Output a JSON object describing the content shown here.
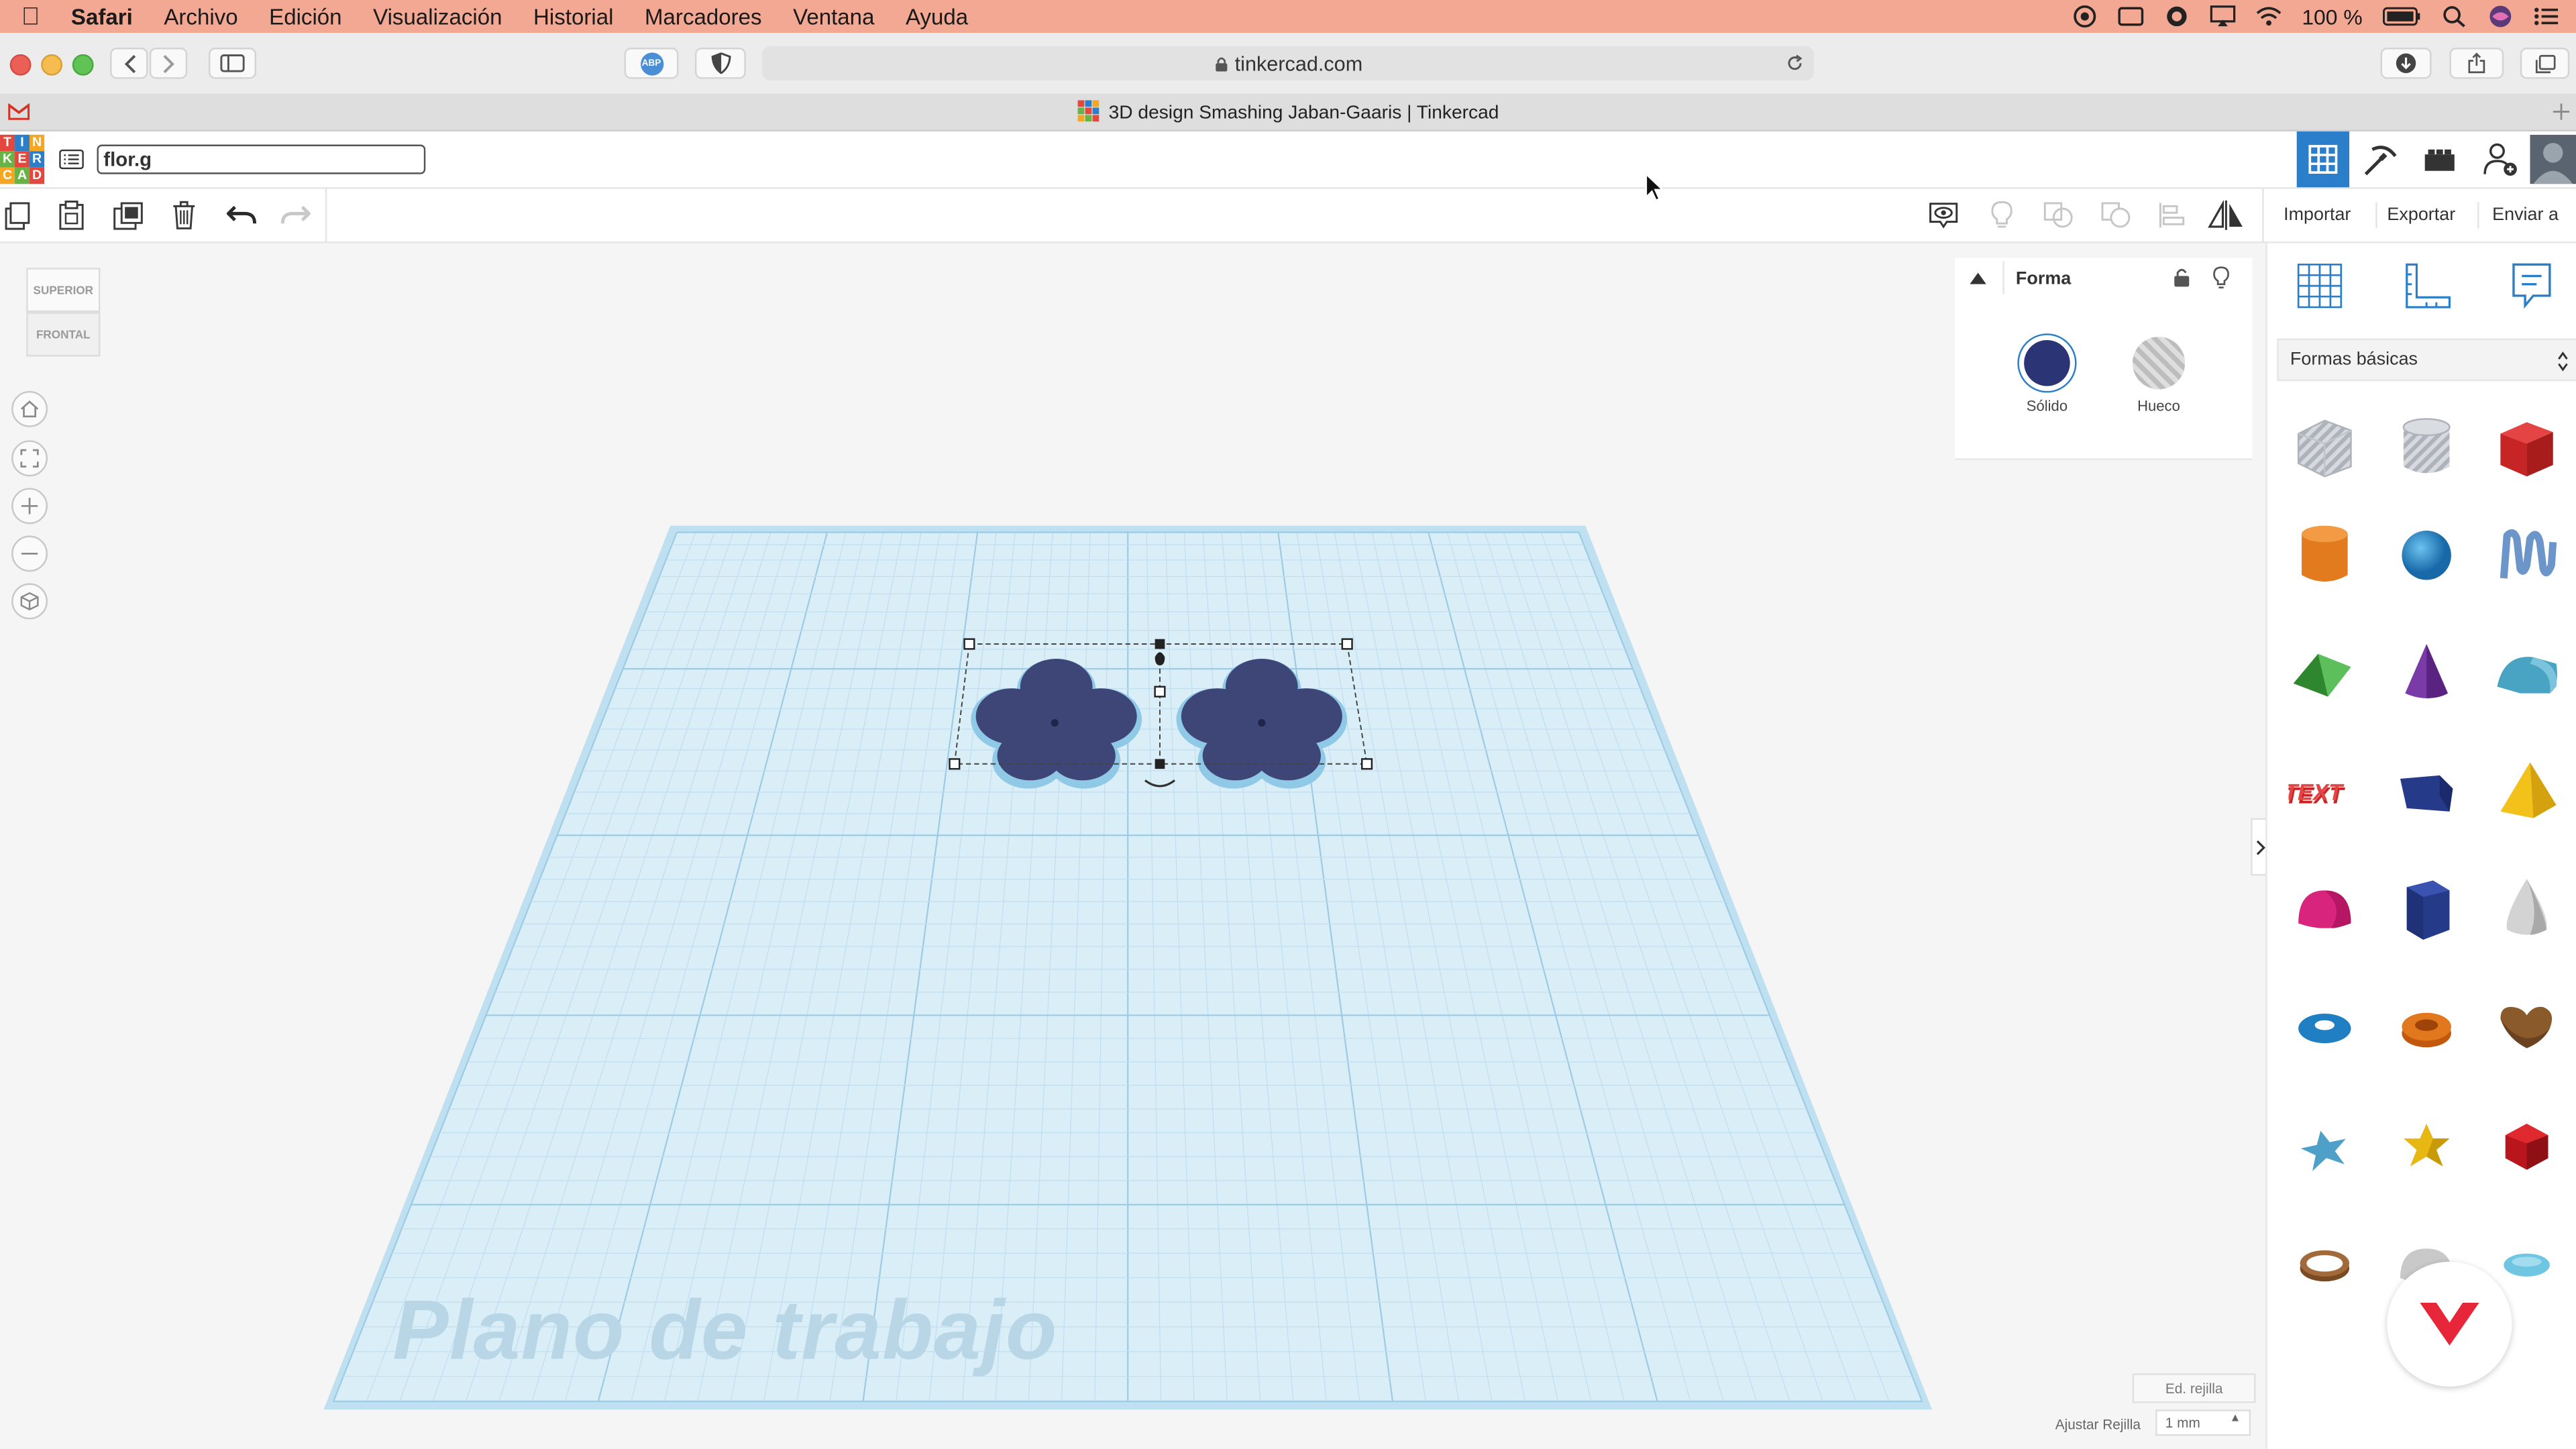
{
  "menubar": {
    "app_name": "Safari",
    "items": [
      "Archivo",
      "Edición",
      "Visualización",
      "Historial",
      "Marcadores",
      "Ventana",
      "Ayuda"
    ],
    "battery": "100 %"
  },
  "browser": {
    "url": "tinkercad.com",
    "tab_title": "3D design Smashing Jaban-Gaaris | Tinkercad",
    "adblock_label": "ABP"
  },
  "app": {
    "logo_letters": [
      "T",
      "I",
      "N",
      "K",
      "E",
      "R",
      "C",
      "A",
      "D"
    ],
    "design_name": "flor.g"
  },
  "toolbar": {
    "import_label": "Importar",
    "export_label": "Exportar",
    "send_label": "Enviar a"
  },
  "viewcube": {
    "top_label": "SUPERIOR",
    "front_label": "FRONTAL"
  },
  "inspector": {
    "title": "Forma",
    "solid_label": "Sólido",
    "hole_label": "Hueco",
    "solid_color": "#2b3475"
  },
  "workspace": {
    "workplane_label": "Plano de trabajo",
    "edit_grid_label": "Ed. rejilla",
    "snap_grid_label": "Ajustar Rejilla",
    "snap_grid_value": "1 mm",
    "shape_color": "#3d4677"
  },
  "shapes_panel": {
    "category": "Formas básicas",
    "shapes": [
      "box-hole",
      "cylinder-hole",
      "box",
      "cylinder",
      "sphere",
      "scribble",
      "roof",
      "cone",
      "round-roof",
      "text",
      "wedge",
      "pyramid",
      "half-sphere",
      "polygon",
      "paraboloid",
      "torus",
      "tube",
      "heart",
      "star",
      "star-gold",
      "icosahedron",
      "ring",
      "half-sphere-gray",
      "ellipsoid"
    ]
  },
  "colors": {
    "menubar_bg": "#f2a893",
    "grid_fill": "#daeef8",
    "grid_border": "#a8d3e8",
    "accent_blue": "#2b7ec9",
    "brand_red": "#e8263a"
  }
}
